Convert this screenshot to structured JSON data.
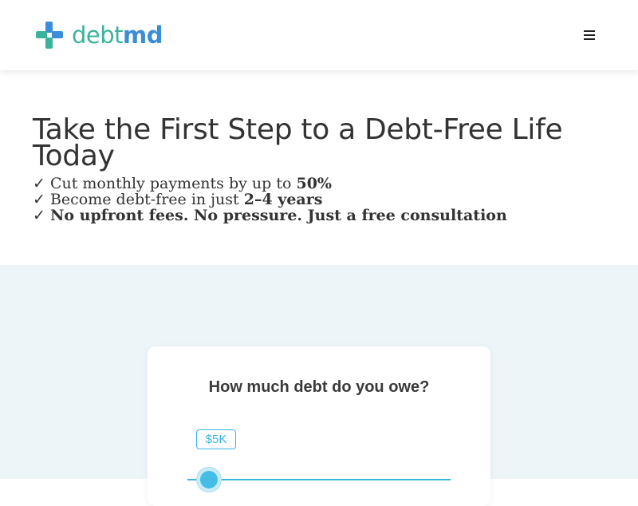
{
  "header": {
    "logo_text_left": "debt",
    "logo_text_right": "md",
    "menu_icon": "hamburger-menu-icon"
  },
  "hero": {
    "title": "Take the First Step to a Debt-Free Life Today",
    "benefits": [
      {
        "prefix": "✓ Cut monthly payments by up to ",
        "bold": "50%"
      },
      {
        "prefix": "✓ Become debt-free in just ",
        "bold": "2–4 years"
      },
      {
        "prefix": "✓ ",
        "bold": "No upfront fees. No pressure. Just a free consultation"
      }
    ]
  },
  "calculator": {
    "question": "How much debt do you owe?",
    "amount_label": "$5K",
    "slider_value_fraction": 0.0
  },
  "colors": {
    "logo_green": "#3bb39a",
    "logo_blue": "#3a8dd6",
    "accent_cyan": "#38b6e0",
    "section_bg": "#eef5f9"
  }
}
